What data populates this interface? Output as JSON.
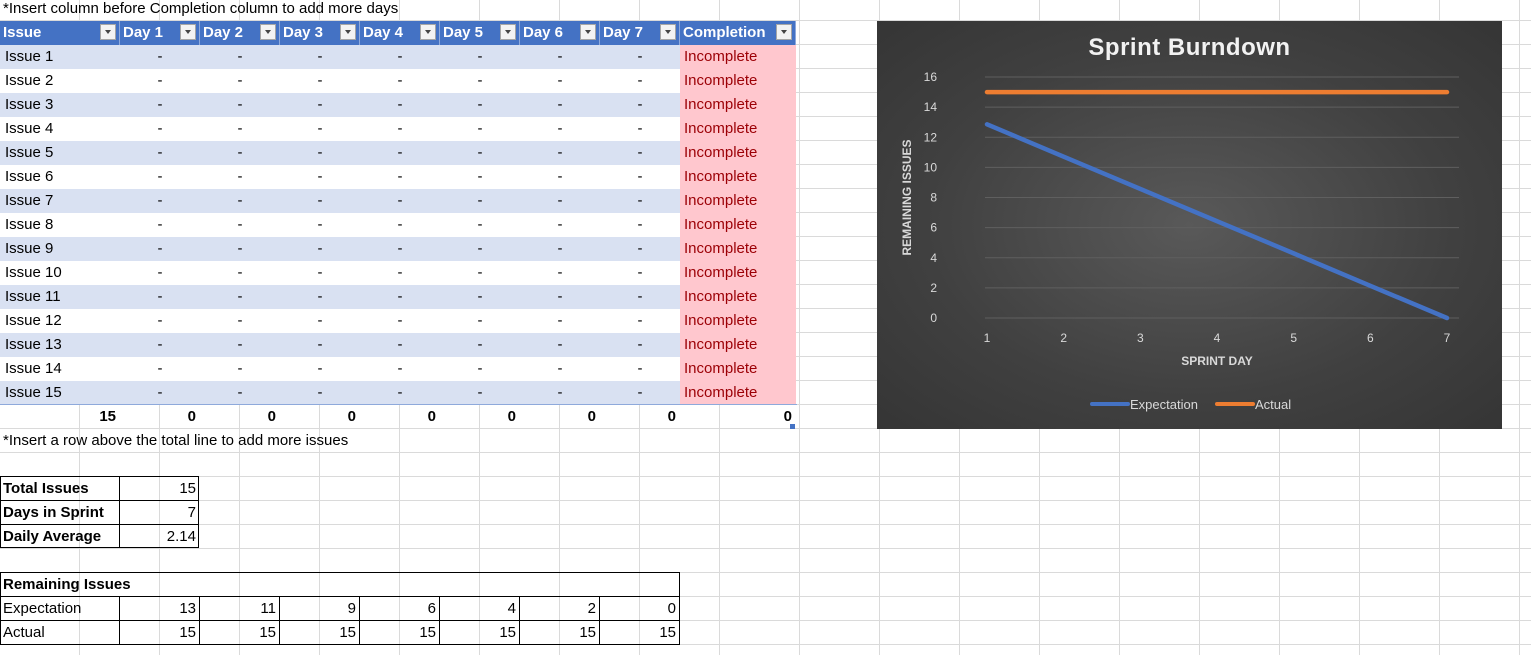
{
  "notes": {
    "top": "*Insert column before Completion column to add more days",
    "bottom": "*Insert a row above the total line to add more issues"
  },
  "table": {
    "headers": [
      "Issue",
      "Day 1",
      "Day 2",
      "Day 3",
      "Day 4",
      "Day 5",
      "Day 6",
      "Day 7",
      "Completion"
    ],
    "rows": [
      {
        "issue": "Issue 1",
        "days": [
          "-",
          "-",
          "-",
          "-",
          "-",
          "-",
          "-"
        ],
        "status": "Incomplete"
      },
      {
        "issue": "Issue 2",
        "days": [
          "-",
          "-",
          "-",
          "-",
          "-",
          "-",
          "-"
        ],
        "status": "Incomplete"
      },
      {
        "issue": "Issue 3",
        "days": [
          "-",
          "-",
          "-",
          "-",
          "-",
          "-",
          "-"
        ],
        "status": "Incomplete"
      },
      {
        "issue": "Issue 4",
        "days": [
          "-",
          "-",
          "-",
          "-",
          "-",
          "-",
          "-"
        ],
        "status": "Incomplete"
      },
      {
        "issue": "Issue 5",
        "days": [
          "-",
          "-",
          "-",
          "-",
          "-",
          "-",
          "-"
        ],
        "status": "Incomplete"
      },
      {
        "issue": "Issue 6",
        "days": [
          "-",
          "-",
          "-",
          "-",
          "-",
          "-",
          "-"
        ],
        "status": "Incomplete"
      },
      {
        "issue": "Issue 7",
        "days": [
          "-",
          "-",
          "-",
          "-",
          "-",
          "-",
          "-"
        ],
        "status": "Incomplete"
      },
      {
        "issue": "Issue 8",
        "days": [
          "-",
          "-",
          "-",
          "-",
          "-",
          "-",
          "-"
        ],
        "status": "Incomplete"
      },
      {
        "issue": "Issue 9",
        "days": [
          "-",
          "-",
          "-",
          "-",
          "-",
          "-",
          "-"
        ],
        "status": "Incomplete"
      },
      {
        "issue": "Issue 10",
        "days": [
          "-",
          "-",
          "-",
          "-",
          "-",
          "-",
          "-"
        ],
        "status": "Incomplete"
      },
      {
        "issue": "Issue 11",
        "days": [
          "-",
          "-",
          "-",
          "-",
          "-",
          "-",
          "-"
        ],
        "status": "Incomplete"
      },
      {
        "issue": "Issue 12",
        "days": [
          "-",
          "-",
          "-",
          "-",
          "-",
          "-",
          "-"
        ],
        "status": "Incomplete"
      },
      {
        "issue": "Issue 13",
        "days": [
          "-",
          "-",
          "-",
          "-",
          "-",
          "-",
          "-"
        ],
        "status": "Incomplete"
      },
      {
        "issue": "Issue 14",
        "days": [
          "-",
          "-",
          "-",
          "-",
          "-",
          "-",
          "-"
        ],
        "status": "Incomplete"
      },
      {
        "issue": "Issue 15",
        "days": [
          "-",
          "-",
          "-",
          "-",
          "-",
          "-",
          "-"
        ],
        "status": "Incomplete"
      }
    ],
    "totals": [
      "15",
      "0",
      "0",
      "0",
      "0",
      "0",
      "0",
      "0",
      "0"
    ]
  },
  "summary": {
    "labels": [
      "Total Issues",
      "Days in Sprint",
      "Daily Average"
    ],
    "values": [
      "15",
      "7",
      "2.14"
    ]
  },
  "remaining": {
    "title": "Remaining Issues",
    "rows": [
      {
        "label": "Expectation",
        "values": [
          "13",
          "11",
          "9",
          "6",
          "4",
          "2",
          "0"
        ]
      },
      {
        "label": "Actual",
        "values": [
          "15",
          "15",
          "15",
          "15",
          "15",
          "15",
          "15"
        ]
      }
    ]
  },
  "colors": {
    "header_bg": "#4472c4",
    "band": "#d9e1f2",
    "incomplete_bg": "#ffc7ce",
    "incomplete_text": "#9c0006",
    "expectation_line": "#4472c4",
    "actual_line": "#ed7d31"
  },
  "icons": {
    "filter": "filter-dropdown-icon"
  },
  "chart_data": {
    "type": "line",
    "title": "Sprint Burndown",
    "xlabel": "SPRINT DAY",
    "ylabel": "REMAINING ISSUES",
    "x": [
      1,
      2,
      3,
      4,
      5,
      6,
      7
    ],
    "x_tick_labels": [
      "1",
      "2",
      "3",
      "4",
      "5",
      "6",
      "7"
    ],
    "y_tick_labels": [
      "0",
      "2",
      "4",
      "6",
      "8",
      "10",
      "12",
      "14",
      "16"
    ],
    "ylim": [
      0,
      16
    ],
    "grid": true,
    "legend_position": "bottom",
    "series": [
      {
        "name": "Expectation",
        "values": [
          12.86,
          10.71,
          8.57,
          6.43,
          4.29,
          2.14,
          0
        ]
      },
      {
        "name": "Actual",
        "values": [
          15,
          15,
          15,
          15,
          15,
          15,
          15
        ]
      }
    ]
  }
}
